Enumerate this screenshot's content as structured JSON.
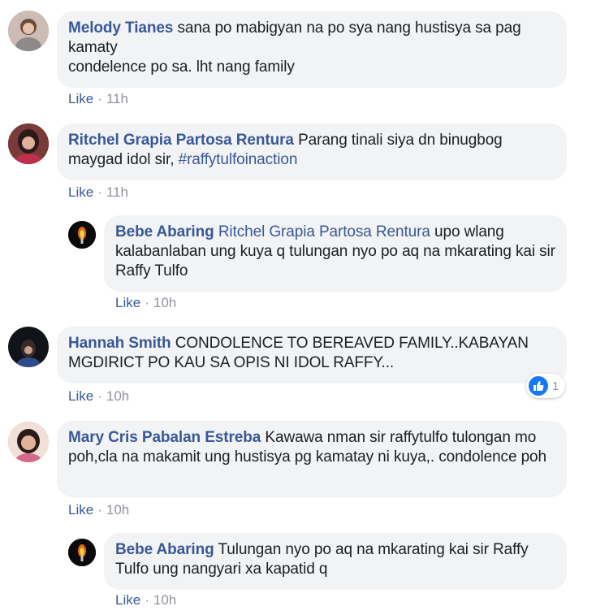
{
  "comments": [
    {
      "author": "Melody Tianes",
      "text": "sana po mabigyan na po sya nang hustisya sa pag kamaty",
      "text2": "condelence po sa. lht nang family",
      "like_label": "Like",
      "time": "11h"
    },
    {
      "author": "Ritchel Grapia Partosa Rentura",
      "text": "Parang tinali siya dn binugbog maygad idol sir,",
      "hashtag": "#raffytulfoinaction",
      "like_label": "Like",
      "time": "11h",
      "reply": {
        "author": "Bebe Abaring",
        "mention": "Ritchel Grapia Partosa Rentura",
        "text": "upo wlang kalabanlaban ung kuya q tulungan nyo po aq na mkarating kai sir Raffy Tulfo",
        "like_label": "Like",
        "time": "10h"
      }
    },
    {
      "author": "Hannah Smith",
      "text": "CONDOLENCE TO BEREAVED FAMILY..KABAYAN MGDIRICT PO KAU SA OPIS NI IDOL RAFFY...",
      "like_label": "Like",
      "time": "10h",
      "reaction_count": "1"
    },
    {
      "author": "Mary Cris Pabalan Estreba",
      "text": "Kawawa nman sir raffytulfo tulongan mo poh,cla na makamit ung hustisya pg kamatay ni kuya,. condolence poh",
      "like_label": "Like",
      "time": "10h",
      "reply": {
        "author": "Bebe Abaring",
        "text": "Tulungan nyo po aq na mkarating kai sir Raffy Tulfo ung nangyari xa kapatid q",
        "like_label": "Like",
        "time": "10h"
      }
    }
  ],
  "separator": "·",
  "colors": {
    "link": "#385898",
    "bubble": "#f2f3f5",
    "like_reaction": "#1877f2"
  }
}
